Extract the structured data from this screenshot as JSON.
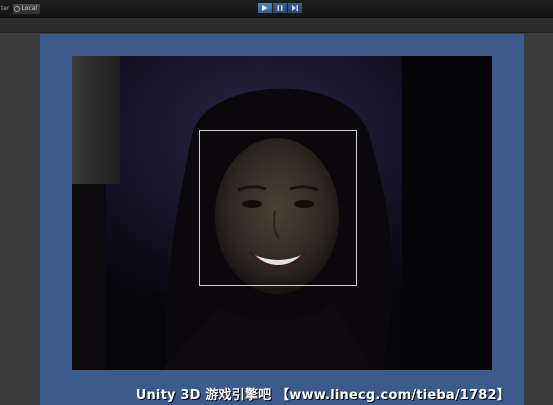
{
  "toolbar": {
    "left_label": "ter",
    "pivot_label": "Local",
    "play_controls": [
      {
        "icon": "play-icon",
        "active": true
      },
      {
        "icon": "pause-icon",
        "active": false
      },
      {
        "icon": "step-icon",
        "active": false
      }
    ]
  },
  "game_view": {
    "background_color": "#3b5b8c",
    "face_frame_color": "#cfcfcf"
  },
  "watermark": {
    "text": "Unity 3D 游戏引擎吧 【www.linecg.com/tieba/1782】"
  }
}
